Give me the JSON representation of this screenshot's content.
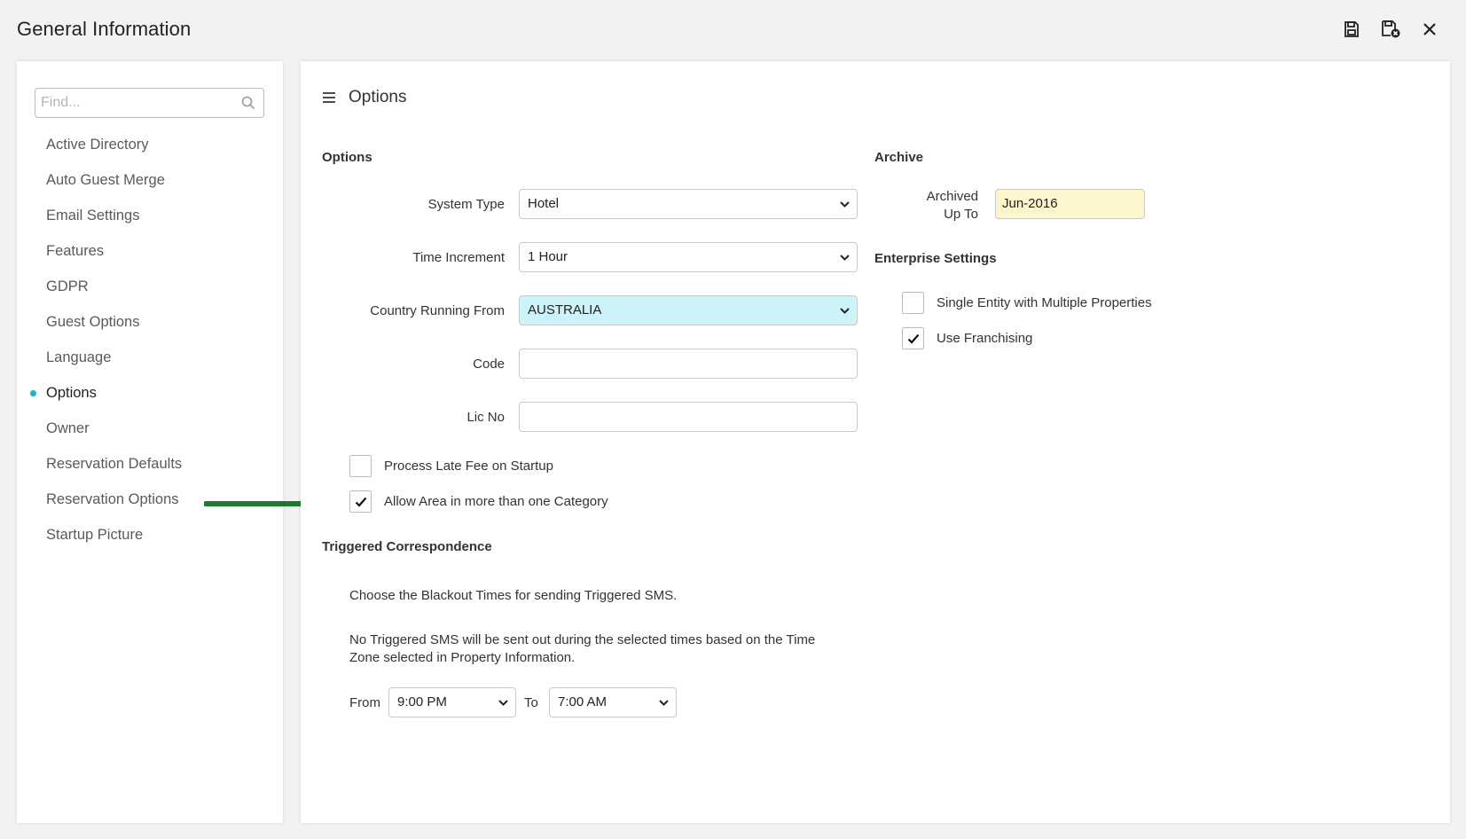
{
  "window": {
    "title": "General Information"
  },
  "toolbar": {
    "save_icon": "save-icon",
    "save_close_icon": "save-close-icon",
    "close_icon": "close-icon"
  },
  "sidebar": {
    "search_placeholder": "Find...",
    "items": [
      {
        "label": "Active Directory"
      },
      {
        "label": "Auto Guest Merge"
      },
      {
        "label": "Email Settings"
      },
      {
        "label": "Features"
      },
      {
        "label": "GDPR"
      },
      {
        "label": "Guest Options"
      },
      {
        "label": "Language"
      },
      {
        "label": "Options",
        "active": true
      },
      {
        "label": "Owner"
      },
      {
        "label": "Reservation Defaults"
      },
      {
        "label": "Reservation Options"
      },
      {
        "label": "Startup Picture"
      }
    ],
    "active_color": "#21b1c4"
  },
  "main": {
    "title": "Options",
    "options": {
      "section_title": "Options",
      "system_type": {
        "label": "System Type",
        "value": "Hotel"
      },
      "time_increment": {
        "label": "Time Increment",
        "value": "1 Hour"
      },
      "country": {
        "label": "Country Running From",
        "value": "AUSTRALIA"
      },
      "code": {
        "label": "Code",
        "value": ""
      },
      "lic_no": {
        "label": "Lic No",
        "value": ""
      },
      "process_late_fee": {
        "label": "Process Late Fee on Startup",
        "checked": false
      },
      "allow_area": {
        "label": "Allow Area in more than one Category",
        "checked": true
      }
    },
    "archive": {
      "section_title": "Archive",
      "archived_up_to_label_1": "Archived",
      "archived_up_to_label_2": "Up To",
      "archived_up_to_value": "Jun-2016"
    },
    "enterprise": {
      "section_title": "Enterprise Settings",
      "single_entity": {
        "label": "Single Entity with Multiple Properties",
        "checked": false
      },
      "use_franchising": {
        "label": "Use Franchising",
        "checked": true
      }
    },
    "triggered": {
      "section_title": "Triggered Correspondence",
      "description_1": "Choose the Blackout Times for sending Triggered SMS.",
      "description_2": "No Triggered SMS will be sent out during the selected times based on the Time Zone selected in Property Information.",
      "from_label": "From",
      "from_value": "9:00 PM",
      "to_label": "To",
      "to_value": "7:00 AM"
    }
  },
  "colors": {
    "highlight_select": "#ccf3f8",
    "readonly_field": "#fdf6cc",
    "annotation_arrow": "#1b7a2b"
  }
}
